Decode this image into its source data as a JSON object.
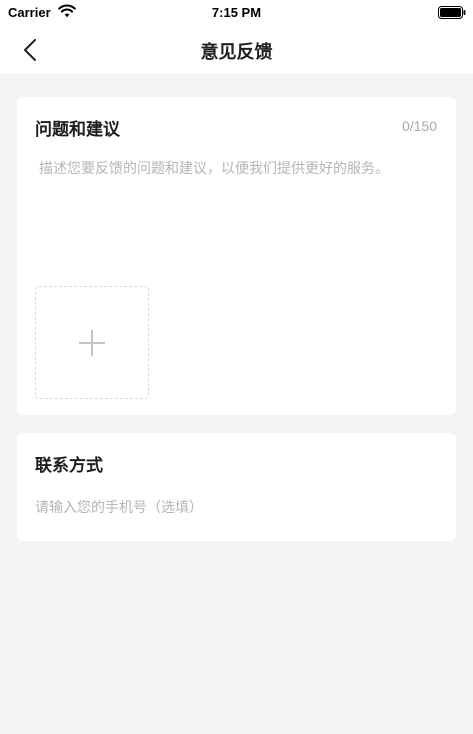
{
  "status_bar": {
    "carrier": "Carrier",
    "time": "7:15 PM"
  },
  "nav": {
    "title": "意见反馈",
    "back_icon": "chevron-left-icon"
  },
  "feedback": {
    "title": "问题和建议",
    "char_count": "0/150",
    "placeholder": "描述您要反馈的问题和建议，以便我们提供更好的服务。",
    "value": "",
    "add_image_icon": "plus-icon"
  },
  "contact": {
    "title": "联系方式",
    "placeholder": "请输入您的手机号（选填）",
    "value": ""
  },
  "colors": {
    "background": "#f4f4f4",
    "card": "#ffffff",
    "placeholder": "#b5b5b5",
    "title_text": "#1d1d1d"
  }
}
